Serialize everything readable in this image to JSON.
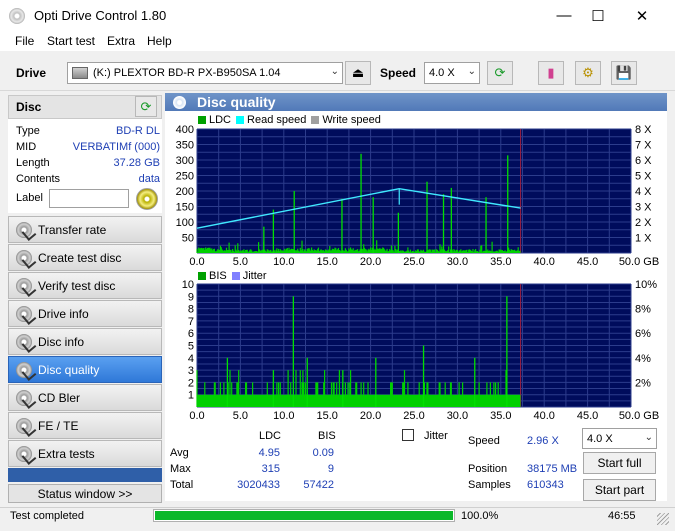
{
  "window": {
    "title": "Opti Drive Control 1.80"
  },
  "menu": [
    {
      "label": "File"
    },
    {
      "label": "Start test"
    },
    {
      "label": "Extra"
    },
    {
      "label": "Help"
    }
  ],
  "toolbar": {
    "drive_label": "Drive",
    "drive_value": "(K:)  PLEXTOR BD-R  PX-B950SA 1.04",
    "speed_label": "Speed",
    "speed_value": "4.0 X"
  },
  "disc": {
    "header": "Disc",
    "rows": [
      {
        "label": "Type",
        "value": "BD-R DL"
      },
      {
        "label": "MID",
        "value": "VERBATIMf (000)"
      },
      {
        "label": "Length",
        "value": "37.28 GB"
      },
      {
        "label": "Contents",
        "value": "data"
      }
    ],
    "label_field": "Label",
    "label_value": ""
  },
  "nav": [
    {
      "label": "Transfer rate",
      "active": false
    },
    {
      "label": "Create test disc",
      "active": false
    },
    {
      "label": "Verify test disc",
      "active": false
    },
    {
      "label": "Drive info",
      "active": false
    },
    {
      "label": "Disc info",
      "active": false
    },
    {
      "label": "Disc quality",
      "active": true
    },
    {
      "label": "CD Bler",
      "active": false
    },
    {
      "label": "FE / TE",
      "active": false
    },
    {
      "label": "Extra tests",
      "active": false
    }
  ],
  "status_window_label": "Status window >>",
  "panel_title": "Disc quality",
  "chart_data": [
    {
      "type": "bar",
      "legend": [
        {
          "name": "LDC",
          "color": "#00a000"
        },
        {
          "name": "Read speed",
          "color": "#00ffff"
        },
        {
          "name": "Write speed",
          "color": "#a0a0a0"
        }
      ],
      "x_ticks": [
        "0.0",
        "5.0",
        "10.0",
        "15.0",
        "20.0",
        "25.0",
        "30.0",
        "35.0",
        "40.0",
        "45.0",
        "50.0 GB"
      ],
      "y_ticks_left": [
        "400",
        "350",
        "300",
        "250",
        "200",
        "150",
        "100",
        "50"
      ],
      "y_ticks_right": [
        "8 X",
        "7 X",
        "6 X",
        "5 X",
        "4 X",
        "3 X",
        "2 X",
        "1 X"
      ],
      "xlim": [
        0,
        50
      ],
      "ylim": [
        0,
        400
      ],
      "y2lim": [
        0,
        8
      ],
      "data_end_gb": 37.28,
      "read_speed": {
        "x": [
          0,
          23.3,
          37.28
        ],
        "y": [
          1.6,
          4.15,
          2.9
        ]
      },
      "ldc_spikes": [
        {
          "x": 7.7,
          "y": 85
        },
        {
          "x": 8.8,
          "y": 140
        },
        {
          "x": 11.2,
          "y": 200
        },
        {
          "x": 16.7,
          "y": 175
        },
        {
          "x": 18.9,
          "y": 320
        },
        {
          "x": 20.3,
          "y": 180
        },
        {
          "x": 23.2,
          "y": 130
        },
        {
          "x": 26.5,
          "y": 230
        },
        {
          "x": 28.4,
          "y": 190
        },
        {
          "x": 29.3,
          "y": 210
        },
        {
          "x": 33.3,
          "y": 180
        },
        {
          "x": 35.8,
          "y": 315
        }
      ]
    },
    {
      "type": "bar",
      "legend": [
        {
          "name": "BIS",
          "color": "#00a000"
        },
        {
          "name": "Jitter",
          "color": "#8080ff"
        }
      ],
      "x_ticks": [
        "0.0",
        "5.0",
        "10.0",
        "15.0",
        "20.0",
        "25.0",
        "30.0",
        "35.0",
        "40.0",
        "45.0",
        "50.0 GB"
      ],
      "y_ticks_left": [
        "10",
        "9",
        "8",
        "7",
        "6",
        "5",
        "4",
        "3",
        "2",
        "1"
      ],
      "y_ticks_right": [
        "10%",
        "8%",
        "6%",
        "4%",
        "2%"
      ],
      "xlim": [
        0,
        50
      ],
      "ylim": [
        0,
        10
      ],
      "data_end_gb": 37.28,
      "bis_spikes": [
        {
          "x": 3.5,
          "y": 4
        },
        {
          "x": 8.8,
          "y": 3
        },
        {
          "x": 11.1,
          "y": 9
        },
        {
          "x": 12.7,
          "y": 4
        },
        {
          "x": 16.8,
          "y": 3
        },
        {
          "x": 20.6,
          "y": 4
        },
        {
          "x": 26.1,
          "y": 5
        },
        {
          "x": 32.0,
          "y": 4
        },
        {
          "x": 35.7,
          "y": 9
        }
      ]
    }
  ],
  "stats": {
    "col_ldc": "LDC",
    "col_bis": "BIS",
    "jitter_label": "Jitter",
    "rows": [
      {
        "label": "Avg",
        "ldc": "4.95",
        "bis": "0.09"
      },
      {
        "label": "Max",
        "ldc": "315",
        "bis": "9"
      },
      {
        "label": "Total",
        "ldc": "3020433",
        "bis": "57422"
      }
    ],
    "speed_label": "Speed",
    "speed_value": "2.96 X",
    "position_label": "Position",
    "position_value": "38175 MB",
    "samples_label": "Samples",
    "samples_value": "610343",
    "speed_select": "4.0 X",
    "start_full": "Start full",
    "start_part": "Start part"
  },
  "statusbar": {
    "text": "Test completed",
    "progress_percent": 100,
    "progress_text": "100.0%",
    "time": "46:55"
  }
}
